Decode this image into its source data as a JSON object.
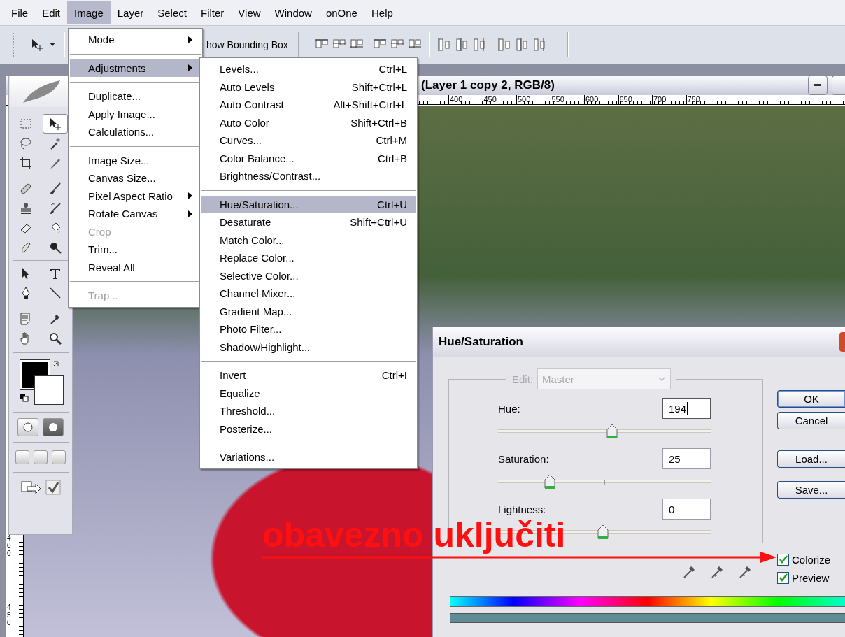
{
  "menu_bar": [
    {
      "label": "File",
      "selected": false
    },
    {
      "label": "Edit",
      "selected": false
    },
    {
      "label": "Image",
      "selected": true
    },
    {
      "label": "Layer",
      "selected": false
    },
    {
      "label": "Select",
      "selected": false
    },
    {
      "label": "Filter",
      "selected": false
    },
    {
      "label": "View",
      "selected": false
    },
    {
      "label": "Window",
      "selected": false
    },
    {
      "label": "onOne",
      "selected": false
    },
    {
      "label": "Help",
      "selected": false
    }
  ],
  "options_bar": {
    "bounding_box_label": "how Bounding Box"
  },
  "toolbox": {
    "tools": [
      {
        "selected": false
      },
      {
        "selected": true
      },
      {
        "selected": false
      },
      {
        "selected": false
      },
      {
        "selected": false
      },
      {
        "selected": false
      },
      {
        "selected": false
      },
      {
        "selected": false
      },
      {
        "selected": false
      },
      {
        "selected": false
      },
      {
        "selected": false
      },
      {
        "selected": false
      },
      {
        "selected": false
      },
      {
        "selected": false
      },
      {
        "selected": false
      },
      {
        "selected": false
      },
      {
        "selected": false
      },
      {
        "selected": false
      },
      {
        "selected": false
      },
      {
        "selected": false
      },
      {
        "selected": false
      },
      {
        "selected": false
      }
    ]
  },
  "document": {
    "title": "(Layer 1 copy 2, RGB/8)",
    "ruler_labels": [
      "400",
      "450",
      "500",
      "550",
      "600",
      "650",
      "700",
      "750"
    ],
    "vertical_ruler_labels": [
      "400",
      "450"
    ]
  },
  "image_menu": {
    "groups": [
      {
        "items": [
          {
            "label": "Mode",
            "submenu": true,
            "disabled": false,
            "selected": false
          }
        ]
      },
      {
        "items": [
          {
            "label": "Adjustments",
            "submenu": true,
            "disabled": false,
            "selected": true
          }
        ]
      },
      {
        "items": [
          {
            "label": "Duplicate...",
            "submenu": false,
            "disabled": false,
            "selected": false
          },
          {
            "label": "Apply Image...",
            "submenu": false,
            "disabled": false,
            "selected": false
          },
          {
            "label": "Calculations...",
            "submenu": false,
            "disabled": false,
            "selected": false
          }
        ]
      },
      {
        "items": [
          {
            "label": "Image Size...",
            "submenu": false,
            "disabled": false,
            "selected": false
          },
          {
            "label": "Canvas Size...",
            "submenu": false,
            "disabled": false,
            "selected": false
          },
          {
            "label": "Pixel Aspect Ratio",
            "submenu": true,
            "disabled": false,
            "selected": false
          },
          {
            "label": "Rotate Canvas",
            "submenu": true,
            "disabled": false,
            "selected": false
          },
          {
            "label": "Crop",
            "submenu": false,
            "disabled": true,
            "selected": false
          },
          {
            "label": "Trim...",
            "submenu": false,
            "disabled": false,
            "selected": false
          },
          {
            "label": "Reveal All",
            "submenu": false,
            "disabled": false,
            "selected": false
          }
        ]
      },
      {
        "items": [
          {
            "label": "Trap...",
            "submenu": false,
            "disabled": true,
            "selected": false
          }
        ]
      }
    ]
  },
  "adjustments_menu": {
    "groups": [
      {
        "items": [
          {
            "label": "Levels...",
            "shortcut": "Ctrl+L",
            "selected": false
          },
          {
            "label": "Auto Levels",
            "shortcut": "Shift+Ctrl+L",
            "selected": false
          },
          {
            "label": "Auto Contrast",
            "shortcut": "Alt+Shift+Ctrl+L",
            "selected": false
          },
          {
            "label": "Auto Color",
            "shortcut": "Shift+Ctrl+B",
            "selected": false
          },
          {
            "label": "Curves...",
            "shortcut": "Ctrl+M",
            "selected": false
          },
          {
            "label": "Color Balance...",
            "shortcut": "Ctrl+B",
            "selected": false
          },
          {
            "label": "Brightness/Contrast...",
            "selected": false
          }
        ]
      },
      {
        "items": [
          {
            "label": "Hue/Saturation...",
            "shortcut": "Ctrl+U",
            "selected": true
          },
          {
            "label": "Desaturate",
            "shortcut": "Shift+Ctrl+U",
            "selected": false
          },
          {
            "label": "Match Color...",
            "selected": false
          },
          {
            "label": "Replace Color...",
            "selected": false
          },
          {
            "label": "Selective Color...",
            "selected": false
          },
          {
            "label": "Channel Mixer...",
            "selected": false
          },
          {
            "label": "Gradient Map...",
            "selected": false
          },
          {
            "label": "Photo Filter...",
            "selected": false
          },
          {
            "label": "Shadow/Highlight...",
            "selected": false
          }
        ]
      },
      {
        "items": [
          {
            "label": "Invert",
            "shortcut": "Ctrl+I",
            "selected": false
          },
          {
            "label": "Equalize",
            "selected": false
          },
          {
            "label": "Threshold...",
            "selected": false
          },
          {
            "label": "Posterize...",
            "selected": false
          }
        ]
      },
      {
        "items": [
          {
            "label": "Variations...",
            "selected": false
          }
        ]
      }
    ]
  },
  "hue_saturation_dialog": {
    "title": "Hue/Saturation",
    "edit_label": "Edit:",
    "edit_value": "Master",
    "edit_disabled": true,
    "sliders": [
      {
        "label": "Hue:",
        "value": "194",
        "level": 0.535,
        "focused": true
      },
      {
        "label": "Saturation:",
        "value": "25",
        "level": 0.245,
        "focused": false
      },
      {
        "label": "Lightness:",
        "value": "0",
        "level": 0.495,
        "focused": false
      }
    ],
    "buttons": [
      {
        "label": "OK",
        "default": true
      },
      {
        "label": "Cancel",
        "default": false
      },
      {
        "label": "Load...",
        "default": false
      },
      {
        "label": "Save...",
        "default": false
      }
    ],
    "checkboxes": [
      {
        "label": "Colorize",
        "checked": true
      },
      {
        "label": "Preview",
        "checked": true
      }
    ]
  },
  "annotation": {
    "text": "obavezno uključiti"
  }
}
